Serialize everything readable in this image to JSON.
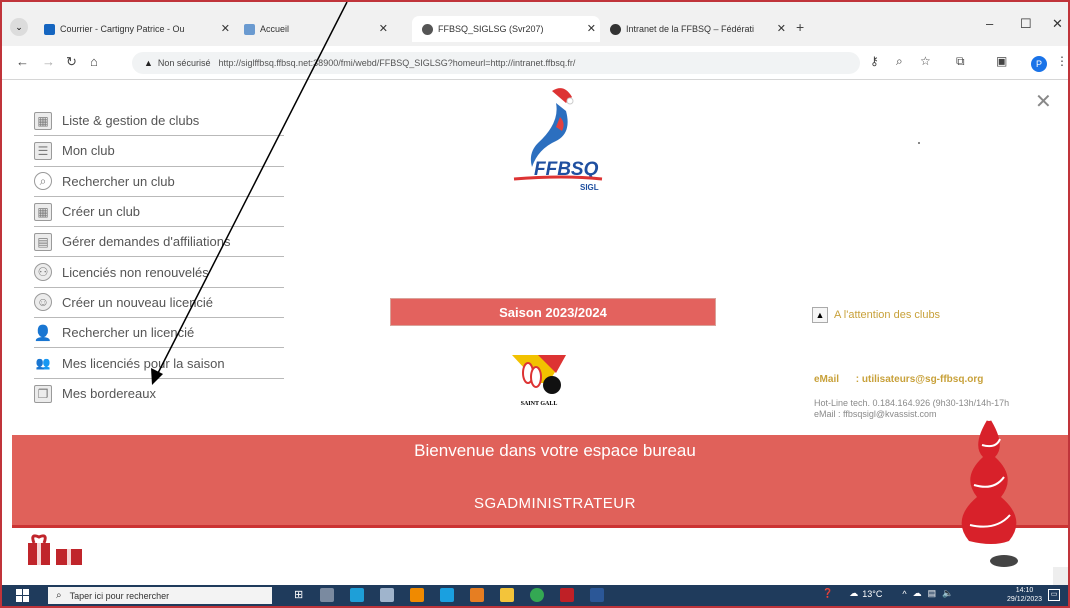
{
  "browser": {
    "tabs": [
      {
        "title": "Courrier - Cartigny Patrice - Ou",
        "favicon_color": "#1565c0"
      },
      {
        "title": "Accueil",
        "favicon_color": "#6a9ad0"
      },
      {
        "title": "FFBSQ_SIGLSG (Svr207)",
        "favicon_color": "#555555",
        "active": true
      },
      {
        "title": "Intranet de la FFBSQ – Fédérati",
        "favicon_color": "#333333"
      }
    ],
    "tab_close": "✕",
    "new_tab": "+",
    "window_controls": {
      "minimize": "–",
      "maximize": "☐",
      "close": "✕"
    },
    "address": {
      "security_label": "Non sécurisé",
      "url": "http://siglffbsq.ffbsq.net:38900/fmi/webd/FFBSQ_SIGLSG?homeurl=http://intranet.ffbsq.fr/"
    },
    "profile_initial": "P"
  },
  "menu": {
    "items": [
      {
        "label": "Liste & gestion de clubs",
        "icon": "table-icon"
      },
      {
        "label": "Mon club",
        "icon": "list-icon"
      },
      {
        "label": "Rechercher un club",
        "icon": "search-icon"
      },
      {
        "label": "Créer un club",
        "icon": "grid-icon"
      },
      {
        "label": "Gérer demandes d'affiliations",
        "icon": "card-icon"
      },
      {
        "label": "Licenciés non renouvelés",
        "icon": "group-icon"
      },
      {
        "label": "Créer un nouveau licencié",
        "icon": "user-circle-icon"
      },
      {
        "label": "Rechercher un licencié",
        "icon": "user-icon"
      },
      {
        "label": "Mes licenciés pour la saison",
        "icon": "users-icon"
      },
      {
        "label": "Mes bordereaux",
        "icon": "documents-icon"
      }
    ]
  },
  "logo": {
    "text": "FFBSQ",
    "sub": "SIGL"
  },
  "season": "Saison 2023/2024",
  "attention": "A l'attention des clubs",
  "contact": {
    "email_label": "eMail",
    "email_value": ": utilisateurs@sg-ffbsq.org",
    "hotline": "Hot-Line tech.  0.184.164.926 (9h30-13h/14h-17h",
    "hotline_email": "eMail      : ffbsqsigl@kvassist.com"
  },
  "club_logo_text": "SAINT GALL",
  "banner": {
    "welcome": "Bienvenue dans votre espace bureau",
    "admin": "SGADMINISTRATEUR"
  },
  "taskbar": {
    "search_placeholder": "Taper ici pour rechercher",
    "weather": "13°C",
    "time": "14:10",
    "date": "29/12/2023"
  },
  "colors": {
    "accent_red": "#e0615a",
    "gold_text": "#c8a13a",
    "taskbar": "#1f3b5c"
  }
}
